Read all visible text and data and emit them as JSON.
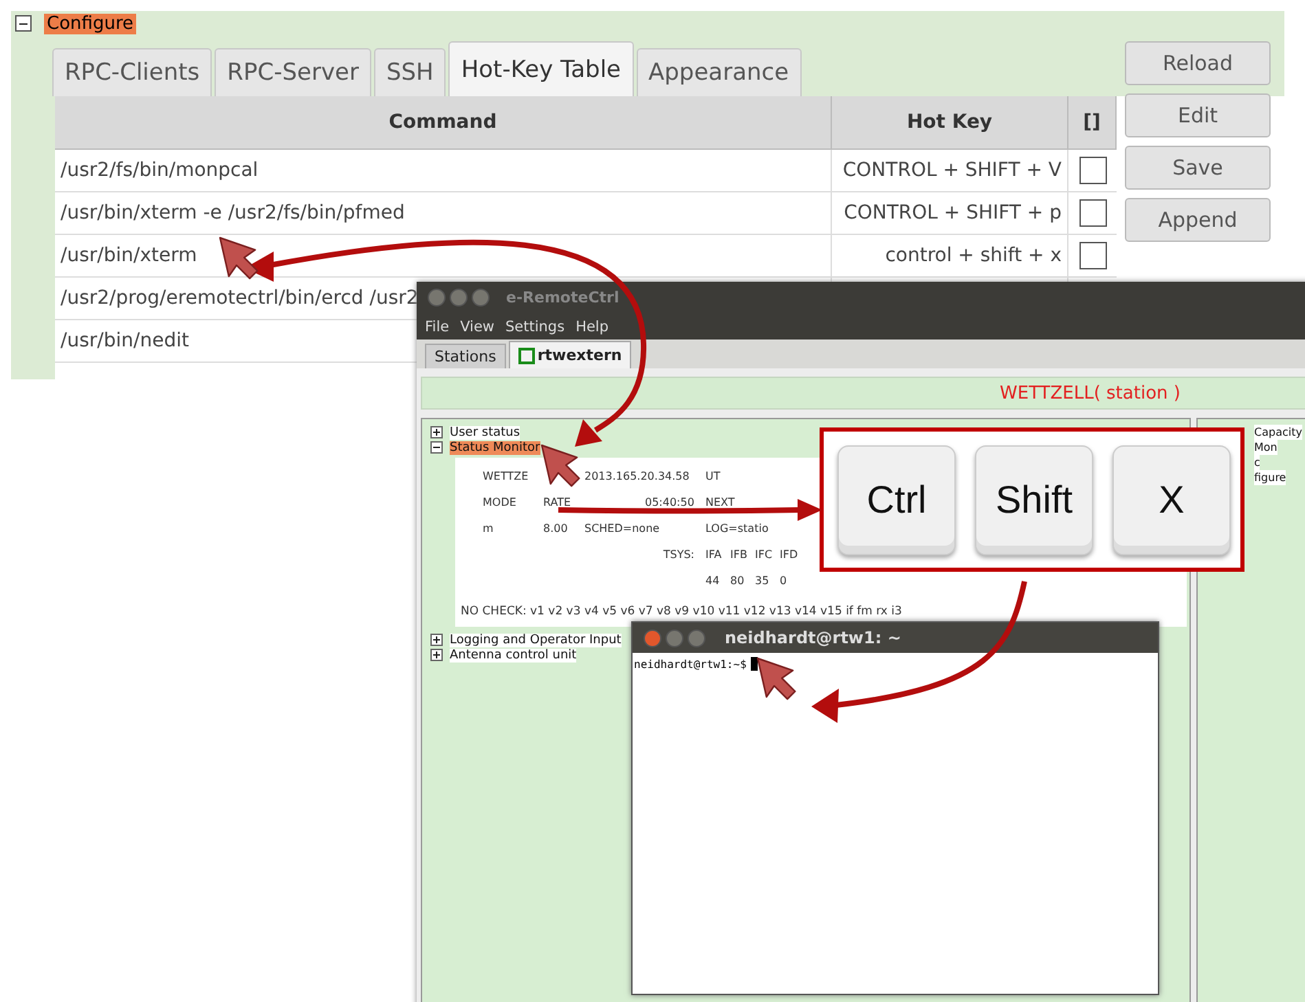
{
  "configure_panel": {
    "title": "Configure",
    "expanded": true,
    "selected": true,
    "tabs": [
      {
        "label": "RPC-Clients",
        "selected": false
      },
      {
        "label": "RPC-Server",
        "selected": false
      },
      {
        "label": "SSH",
        "selected": false
      },
      {
        "label": "Hot-Key Table",
        "selected": true
      },
      {
        "label": "Appearance",
        "selected": false
      }
    ],
    "table": {
      "columns": [
        "Command",
        "Hot Key",
        "[]"
      ],
      "rows": [
        {
          "command": "/usr2/fs/bin/monpcal",
          "hot_key": "CONTROL + SHIFT + V",
          "checked": false
        },
        {
          "command": "/usr/bin/xterm -e /usr2/fs/bin/pfmed",
          "hot_key": "CONTROL + SHIFT + p",
          "checked": false
        },
        {
          "command": "/usr/bin/xterm",
          "hot_key": "control + shift + x",
          "checked": false
        },
        {
          "command": "/usr2/prog/eremotectrl/bin/ercd /usr2"
        },
        {
          "command": "/usr/bin/nedit"
        }
      ]
    },
    "buttons": [
      "Reload",
      "Edit",
      "Save",
      "Append"
    ]
  },
  "remote_window": {
    "title": "e-RemoteCtrl",
    "menu": [
      "File",
      "View",
      "Settings",
      "Help"
    ],
    "tabs": [
      {
        "label": "Stations",
        "selected": false
      },
      {
        "label": "rtwextern",
        "selected": true
      }
    ],
    "station_banner": "WETTZELL( station )",
    "tree": [
      {
        "label": "User status",
        "expanded": false,
        "selected": false
      },
      {
        "label": "Status Monitor",
        "expanded": true,
        "selected": true,
        "monitor": {
          "lines": [
            {
              "kind": "time",
              "cells": [
                "WETTZE",
                "2013.165.20.34.58",
                "UT"
              ]
            },
            {
              "kind": "mode",
              "cells": [
                "MODE",
                "RATE",
                "05:40:50",
                "NEXT"
              ]
            },
            {
              "kind": "sched",
              "cells": [
                "m",
                "8.00",
                "SCHED=none",
                "LOG=statio"
              ]
            },
            {
              "kind": "tsys",
              "cells": [
                "TSYS:",
                "IFA",
                "IFB",
                "IFC",
                "IFD"
              ]
            },
            {
              "kind": "values",
              "cells": [
                "44",
                "80",
                "35",
                "0"
              ]
            }
          ],
          "no_check": "NO CHECK: v1 v2 v3 v4 v5 v6 v7 v8 v9 v10 v11 v12 v13 v14 v15 if fm rx i3"
        }
      },
      {
        "label": "Logging and Operator Input",
        "expanded": false,
        "selected": false
      },
      {
        "label": "Antenna control unit",
        "expanded": false,
        "selected": false
      }
    ],
    "side_items": [
      "Capacity",
      "Mon",
      "c",
      "figure"
    ]
  },
  "terminal_window": {
    "title": "neidhardt@rtw1: ~",
    "prompt": "neidhardt@rtw1:~$"
  },
  "key_callout": {
    "keys": [
      "Ctrl",
      "Shift",
      "X"
    ]
  }
}
